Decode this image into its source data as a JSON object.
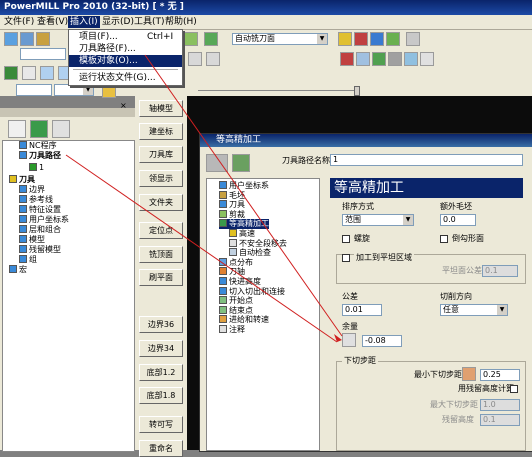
{
  "window": {
    "title": "PowerMILL Pro 2010 (32-bit)    [ * 无 ]"
  },
  "menu": [
    "文件(F)",
    "查看(V)",
    "插入(I)",
    "显示(D)",
    "工具(T)",
    "帮助(H)"
  ],
  "insert_menu": {
    "items": [
      {
        "label": "项目(F)...",
        "shortcut": "Ctrl+I"
      },
      {
        "label": "刀具路径(F)...",
        "shortcut": ""
      },
      {
        "label": "模板对象(O)...",
        "shortcut": ""
      },
      {
        "label": "运行状态文件(G)...",
        "shortcut": ""
      }
    ],
    "selected_index": 2
  },
  "toolbar": {
    "strategy_combo": "自动铣刀面"
  },
  "explorer": {
    "tree": [
      {
        "label": "NC程序",
        "level": 1,
        "icon_color": "#3a8ad8"
      },
      {
        "label": "刀具路径",
        "level": 1,
        "icon_color": "#3a8ad8",
        "bold": true
      },
      {
        "label": "1",
        "level": 2,
        "icon_color": "#2a9a2a"
      },
      {
        "label": "刀具",
        "level": 0,
        "icon_color": "#e0c020",
        "bold": true
      },
      {
        "label": "边界",
        "level": 1,
        "icon_color": "#3a8ad8"
      },
      {
        "label": "参考线",
        "level": 1,
        "icon_color": "#3a8ad8"
      },
      {
        "label": "特征设置",
        "level": 1,
        "icon_color": "#3a8ad8"
      },
      {
        "label": "用户坐标系",
        "level": 1,
        "icon_color": "#3a8ad8"
      },
      {
        "label": "层和组合",
        "level": 1,
        "icon_color": "#3a8ad8"
      },
      {
        "label": "模型",
        "level": 1,
        "icon_color": "#3a8ad8"
      },
      {
        "label": "残留模型",
        "level": 1,
        "icon_color": "#3a8ad8"
      },
      {
        "label": "组",
        "level": 1,
        "icon_color": "#3a8ad8"
      },
      {
        "label": "宏",
        "level": 0,
        "icon_color": "#3a8ad8"
      }
    ]
  },
  "side_buttons": [
    "轴模型",
    "建坐标",
    "刀具库",
    "领显示",
    "文件夹",
    "定位点",
    "铣顶面",
    "刷平面",
    "边界36",
    "边界34",
    "底部1.2",
    "底部1.8",
    "转可写",
    "重命名"
  ],
  "dialog": {
    "title": "等高精加工",
    "toolpath_name_label": "刀具路径名称",
    "toolpath_name": "1",
    "tree": [
      "用户坐标系",
      "毛坯",
      "刀具",
      "剪裁",
      "等高精加工",
      "高速",
      "不安全段移去",
      "自动检查",
      "点分布",
      "刀轴",
      "快进高度",
      "切入切出和连接",
      "开始点",
      "结束点",
      "进给和转速",
      "注释"
    ],
    "heading": "等高精加工",
    "sort_label": "排序方式",
    "sort_value": "范围",
    "extra_stock_label": "额外毛坯",
    "extra_stock_value": "0.0",
    "spiral_label": "螺旋",
    "steep_label": "倒勾形面",
    "flat_label": "加工到平坦区域",
    "flat_tol_label": "平坦面公差",
    "flat_tol_value": "0.1",
    "tolerance_label": "公差",
    "tolerance_value": "0.01",
    "cut_dir_label": "切削方向",
    "cut_dir_value": "任意",
    "thickness_label": "余量",
    "thickness_value": "-0.08",
    "stepdown_label": "下切步距",
    "min_stepdown_label": "最小下切步距",
    "min_stepdown_value": "0.25",
    "residual_label": "用残留高度计算",
    "max_stepdown_label": "最大下切步距",
    "max_stepdown_value": "1.0",
    "cusp_label": "残留高度",
    "cusp_value": "0.1"
  }
}
